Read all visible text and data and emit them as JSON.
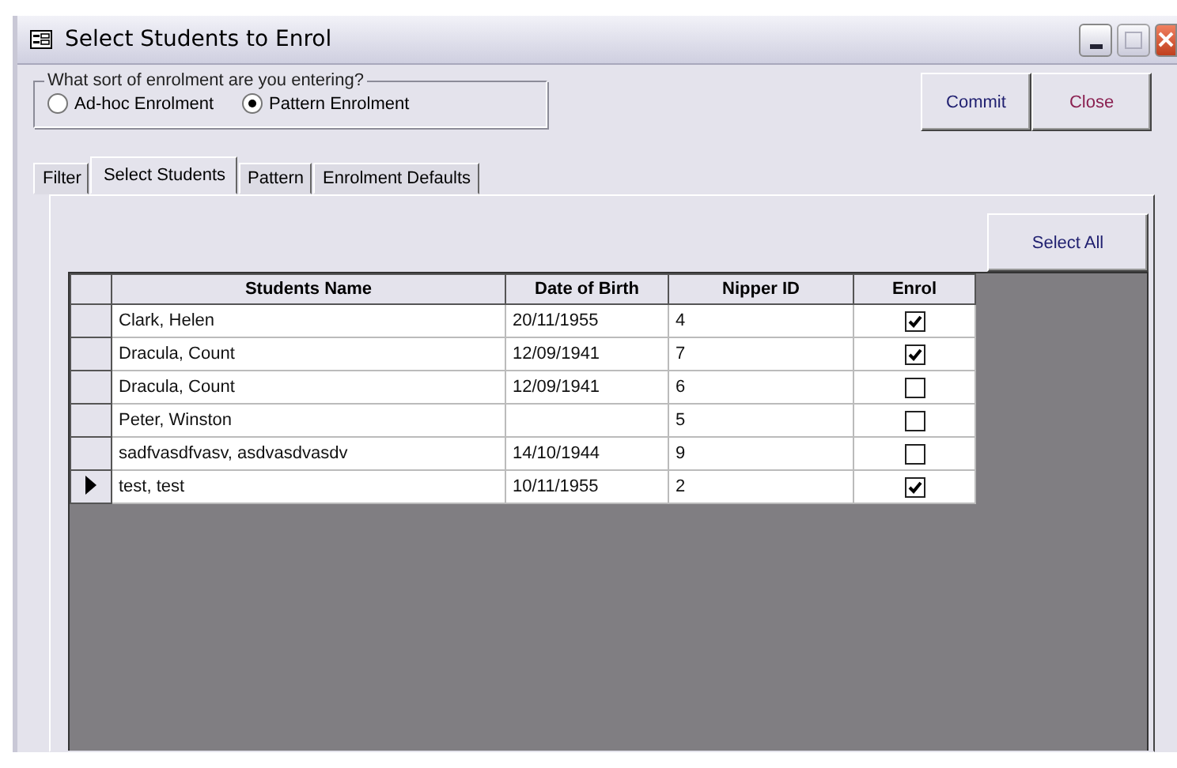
{
  "window": {
    "title": "Select Students to Enrol"
  },
  "enrolment_type": {
    "legend": "What sort of enrolment are you entering?",
    "options": [
      {
        "label": "Ad-hoc Enrolment",
        "selected": false
      },
      {
        "label": "Pattern Enrolment",
        "selected": true
      }
    ]
  },
  "buttons": [
    {
      "label": "Commit",
      "kind": "commit"
    },
    {
      "label": "Close",
      "kind": "close"
    }
  ],
  "tabs": [
    {
      "label": "Filter",
      "selected": false
    },
    {
      "label": "Select Students",
      "selected": true
    },
    {
      "label": "Pattern",
      "selected": false
    },
    {
      "label": "Enrolment Defaults",
      "selected": false
    }
  ],
  "select_all": "Select All",
  "table": {
    "columns": [
      "Students Name",
      "Date of Birth",
      "Nipper ID",
      "Enrol"
    ],
    "rows": [
      {
        "name": "Clark, Helen",
        "dob": "20/11/1955",
        "nipper_id": "4",
        "enrol": true,
        "current": false
      },
      {
        "name": "Dracula, Count",
        "dob": "12/09/1941",
        "nipper_id": "7",
        "enrol": true,
        "current": false
      },
      {
        "name": "Dracula, Count",
        "dob": "12/09/1941",
        "nipper_id": "6",
        "enrol": false,
        "current": false
      },
      {
        "name": "Peter, Winston",
        "dob": "",
        "nipper_id": "5",
        "enrol": false,
        "current": false
      },
      {
        "name": "sadfvasdfvasv, asdvasdvasdv",
        "dob": "14/10/1944",
        "nipper_id": "9",
        "enrol": false,
        "current": false
      },
      {
        "name": "test, test",
        "dob": "10/11/1955",
        "nipper_id": "2",
        "enrol": true,
        "current": true
      }
    ]
  }
}
